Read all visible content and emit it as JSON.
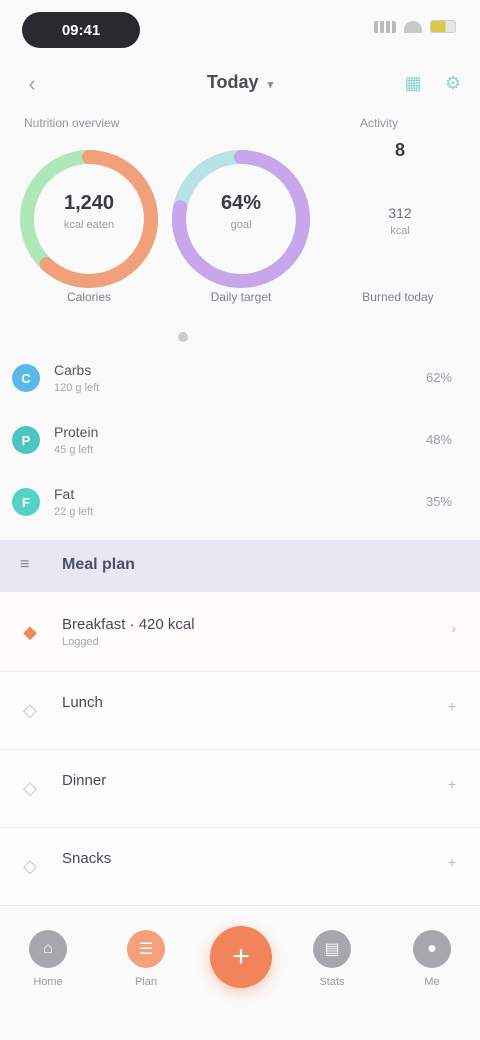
{
  "status_bar": {
    "time": "09:41"
  },
  "header": {
    "title": "Today",
    "back_icon": "chevron-left-icon",
    "title_chevron": "▾"
  },
  "summary": {
    "left_label": "Nutrition overview",
    "right_label": "Activity",
    "rings": [
      {
        "value": "1,240",
        "unit": "kcal eaten",
        "caption": "Calories",
        "progress": 0.62,
        "color": "#f2a07c",
        "track": "#9be2a8"
      },
      {
        "value": "64%",
        "unit": "goal",
        "caption": "Daily target",
        "progress": 0.78,
        "color": "#c7a6ec",
        "track": "#a9dbe3"
      }
    ],
    "side": {
      "value": "8",
      "mid": "312",
      "small": "kcal",
      "caption": "Burned today"
    }
  },
  "nutrients": [
    {
      "name": "Carbs",
      "sub": "120 g left",
      "value": "62%",
      "icon_color": "#5ab9e8",
      "icon_letter": "C"
    },
    {
      "name": "Protein",
      "sub": "45 g left",
      "value": "48%",
      "icon_color": "#4dc6c2",
      "icon_letter": "P"
    },
    {
      "name": "Fat",
      "sub": "22 g left",
      "value": "35%",
      "icon_color": "#57d1c8",
      "icon_letter": "F"
    }
  ],
  "section": {
    "title": "Meal plan"
  },
  "meals": [
    {
      "title": "Breakfast · 420 kcal",
      "sub": "Logged",
      "right": "›",
      "active": true
    },
    {
      "title": "Lunch",
      "sub": "",
      "right": "+",
      "active": false
    },
    {
      "title": "Dinner",
      "sub": "",
      "right": "+",
      "active": false
    },
    {
      "title": "Snacks",
      "sub": "",
      "right": "+",
      "active": false
    }
  ],
  "bottom_nav": {
    "items": [
      {
        "label": "Home",
        "icon": "home-icon",
        "glyph": "⌂"
      },
      {
        "label": "Plan",
        "icon": "plan-icon",
        "glyph": "☰"
      },
      {
        "label": "Stats",
        "icon": "stats-icon",
        "glyph": "▤"
      },
      {
        "label": "Me",
        "icon": "user-icon",
        "glyph": "●"
      }
    ],
    "fab_glyph": "+"
  }
}
